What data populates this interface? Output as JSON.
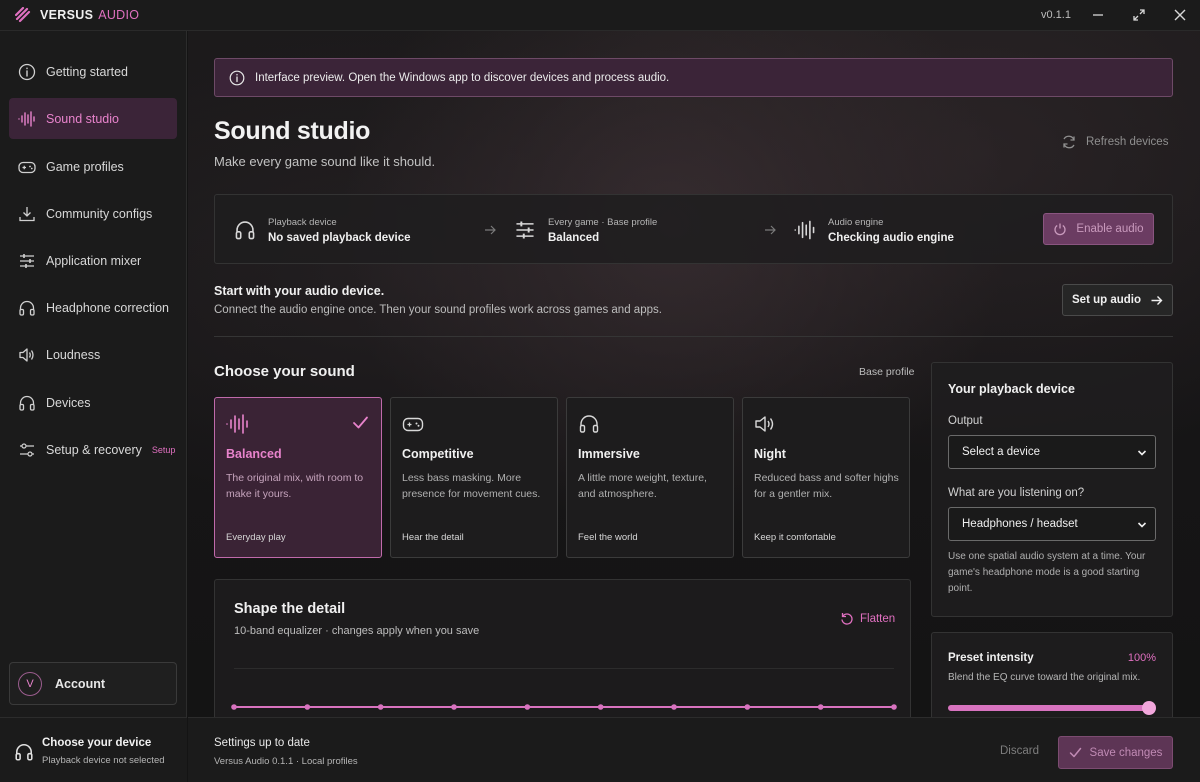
{
  "app": {
    "name": "VERSUS",
    "name_suffix": "AUDIO",
    "version": "v0.1.1"
  },
  "sidebar": {
    "items": [
      {
        "label": "Getting started",
        "icon": "info-icon"
      },
      {
        "label": "Sound studio",
        "icon": "waveform-icon",
        "active": true
      },
      {
        "label": "Game profiles",
        "icon": "gamepad-icon"
      },
      {
        "label": "Community configs",
        "icon": "download-icon"
      },
      {
        "label": "Application mixer",
        "icon": "sliders-icon"
      },
      {
        "label": "Headphone correction",
        "icon": "headphones-icon"
      },
      {
        "label": "Loudness",
        "icon": "speaker-icon"
      },
      {
        "label": "Devices",
        "icon": "headphones-icon"
      },
      {
        "label": "Setup & recovery",
        "icon": "setup-icon",
        "tag": "Setup"
      }
    ],
    "account": {
      "avatar": "V",
      "label": "Account"
    },
    "footer": {
      "title": "Choose your device",
      "subtitle": "Playback device not selected"
    }
  },
  "banner": {
    "text": "Interface preview. Open the Windows app to discover devices and process audio."
  },
  "page": {
    "title": "Sound studio",
    "subtitle": "Make every game sound like it should.",
    "refresh_label": "Refresh devices"
  },
  "status": {
    "playback": {
      "label": "Playback device",
      "value": "No saved playback device"
    },
    "profile": {
      "label": "Every game · Base profile",
      "value": "Balanced"
    },
    "engine": {
      "label": "Audio engine",
      "value": "Checking audio engine"
    },
    "enable_label": "Enable audio"
  },
  "setup": {
    "title": "Start with your audio device.",
    "subtitle": "Connect the audio engine once. Then your sound profiles work across games and apps.",
    "button_label": "Set up audio"
  },
  "choose": {
    "title": "Choose your sound",
    "side_label": "Base profile",
    "cards": [
      {
        "title": "Balanced",
        "desc": "The original mix, with room to make it yours.",
        "foot": "Everyday play",
        "icon": "waveform-icon",
        "selected": true
      },
      {
        "title": "Competitive",
        "desc": "Less bass masking. More presence for movement cues.",
        "foot": "Hear the detail",
        "icon": "gamepad-icon"
      },
      {
        "title": "Immersive",
        "desc": "A little more weight, texture, and atmosphere.",
        "foot": "Feel the world",
        "icon": "headphones-icon"
      },
      {
        "title": "Night",
        "desc": "Reduced bass and softer highs for a gentler mix.",
        "foot": "Keep it comfortable",
        "icon": "speaker-icon"
      }
    ]
  },
  "equalizer": {
    "title": "Shape the detail",
    "subtitle": "10-band equalizer · changes apply when you save",
    "flatten_label": "Flatten",
    "bands": 10
  },
  "playback_device": {
    "title": "Your playback device",
    "output_label": "Output",
    "output_value": "Select a device",
    "listening_label": "What are you listening on?",
    "listening_value": "Headphones / headset",
    "help": "Use one spatial audio system at a time. Your game's headphone mode is a good starting point."
  },
  "intensity": {
    "title": "Preset intensity",
    "value_label": "100%",
    "value": 1.0,
    "subtitle": "Blend the EQ curve toward the original mix."
  },
  "footer": {
    "status": "Settings up to date",
    "meta": "Versus Audio 0.1.1 · Local profiles",
    "discard_label": "Discard",
    "save_label": "Save changes"
  },
  "colors": {
    "accent": "#e070c0",
    "accent_bg": "#3b2438"
  }
}
